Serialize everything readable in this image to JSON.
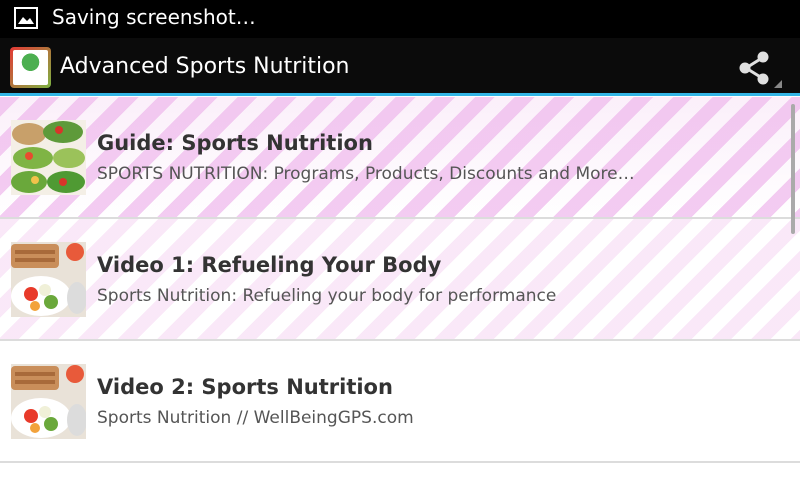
{
  "status_bar": {
    "text": "Saving screenshot…",
    "icon": "image-icon"
  },
  "action_bar": {
    "title": "Advanced Sports Nutrition",
    "share_icon": "share-icon",
    "accent": "#33b5e5"
  },
  "list": {
    "items": [
      {
        "title": "Guide: Sports Nutrition",
        "subtitle": "SPORTS NUTRITION: Programs, Products, Discounts and More…"
      },
      {
        "title": "Video 1: Refueling Your Body",
        "subtitle": "Sports Nutrition: Refueling your body for performance"
      },
      {
        "title": "Video 2: Sports Nutrition",
        "subtitle": "Sports Nutrition // WellBeingGPS.com"
      }
    ]
  }
}
